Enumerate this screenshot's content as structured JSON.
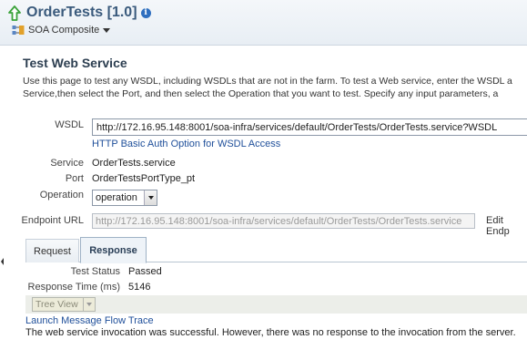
{
  "header": {
    "title": "OrderTests [1.0]",
    "composite_menu_label": "SOA Composite",
    "icons": {
      "up": "green-up-arrow-icon",
      "info": "info-icon",
      "composite": "composite-icon"
    }
  },
  "page": {
    "section_title": "Test Web Service",
    "description_line1": "Use this page to test any WSDL, including WSDLs that are not in the farm. To test a Web service, enter the WSDL a",
    "description_line2": "Service,then select the Port, and then select the Operation that you want to test. Specify any input parameters, a"
  },
  "form": {
    "wsdl_label": "WSDL",
    "wsdl_value": "http://172.16.95.148:8001/soa-infra/services/default/OrderTests/OrderTests.service?WSDL",
    "http_auth_link": "HTTP Basic Auth Option for WSDL Access",
    "service_label": "Service",
    "service_value": "OrderTests.service",
    "port_label": "Port",
    "port_value": "OrderTestsPortType_pt",
    "operation_label": "Operation",
    "operation_value": "operation",
    "endpoint_label": "Endpoint URL",
    "endpoint_value": "http://172.16.95.148:8001/soa-infra/services/default/OrderTests/OrderTests.service",
    "edit_endpoint_label": "Edit Endp"
  },
  "tabs": [
    {
      "label": "Request",
      "active": false
    },
    {
      "label": "Response",
      "active": true
    }
  ],
  "response": {
    "test_status_label": "Test Status",
    "test_status_value": "Passed",
    "response_time_label": "Response Time (ms)",
    "response_time_value": "5146",
    "view_select": "Tree View",
    "trace_link": "Launch Message Flow Trace",
    "message": "The web service invocation was successful. However, there was no response to the invocation from the server."
  },
  "colors": {
    "link": "#1f4f9a",
    "title": "#3a5a7c",
    "up_arrow": "#3aa23a",
    "info": "#2f6fbf"
  }
}
